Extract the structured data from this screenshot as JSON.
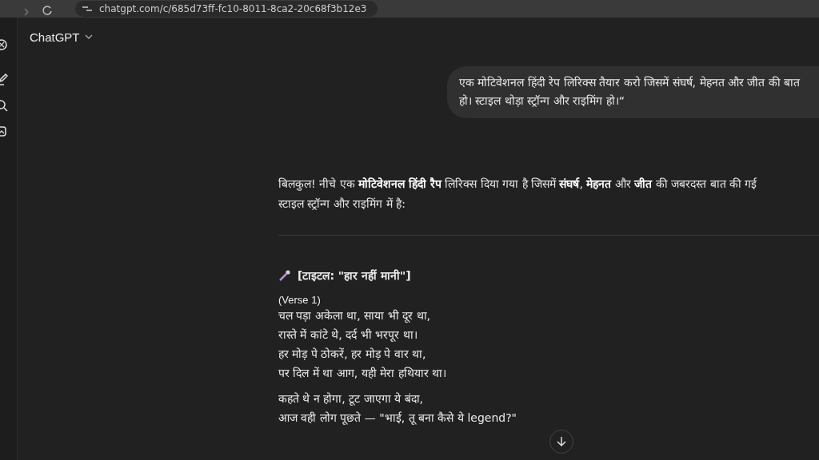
{
  "browser": {
    "url": "chatgpt.com/c/685d73ff-fc10-8011-8ca2-20c68f3b12e3"
  },
  "header": {
    "title": "ChatGPT"
  },
  "user_message": "एक मोटिवेशनल हिंदी रेप लिरिक्स तैयार करो जिसमें संघर्ष, मेहनत और जीत की बात हो। स्टाइल थोड़ा स्ट्रॉन्ग और राइमिंग हो।“",
  "response": {
    "intro": [
      "बिलकुल! नीचे एक **मोटिवेशनल हिंदी रैप** लिरिक्स दिया गया है जिसमें **संघर्ष**, **मेहनत** और **जीत** की जबरदस्त बात की गई",
      "स्टाइल स्ट्रॉन्ग और राइमिंग में है:"
    ],
    "song_title": "[टाइटल: \"हार नहीं मानी\"]",
    "section_label": "(Verse 1)",
    "stanzas": [
      [
        "चल पड़ा अकेला था, साया भी दूर था,",
        "रास्ते में कांटे थे, दर्द भी भरपूर था।",
        "हर मोड़ पे ठोकरें, हर मोड़ पे वार था,",
        "पर दिल में था आग, यही मेरा हथियार था।"
      ],
      [
        "कहते थे न होगा, टूट जाएगा ये बंदा,",
        "आज वही लोग पूछते — \"भाई, तू बना कैसे ये legend?\""
      ]
    ]
  }
}
